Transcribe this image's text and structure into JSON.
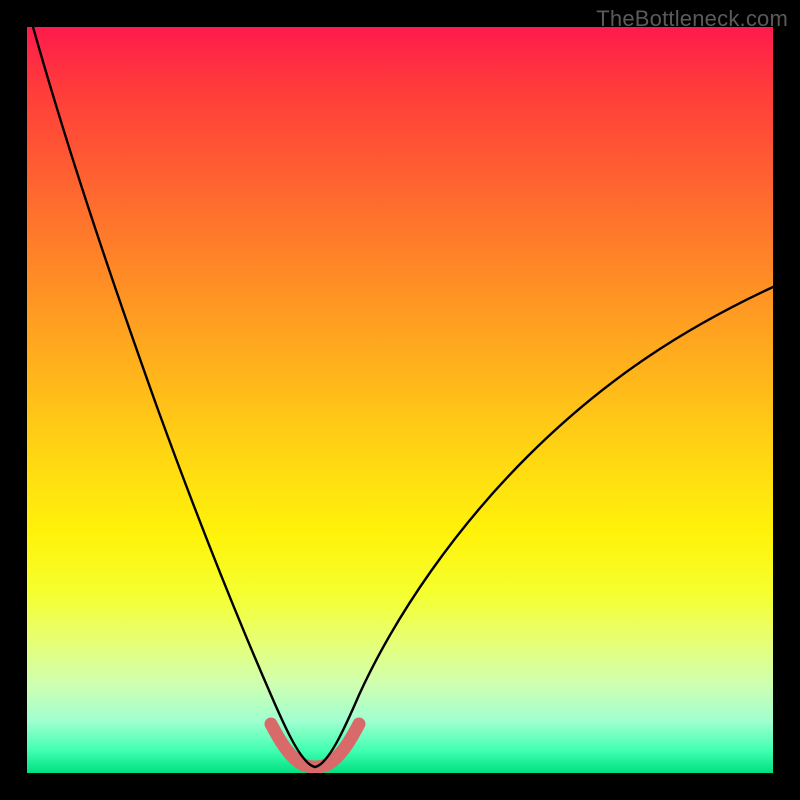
{
  "watermark": "TheBottleneck.com",
  "colors": {
    "background": "#000000",
    "gradient_top": "#ff1a4d",
    "gradient_bottom": "#00e080",
    "curve": "#000000",
    "highlight": "#d86a6a"
  },
  "chart_data": {
    "type": "line",
    "title": "",
    "xlabel": "",
    "ylabel": "",
    "xlim": [
      0,
      100
    ],
    "ylim": [
      0,
      100
    ],
    "grid": false,
    "legend": false,
    "description": "V-shaped bottleneck curve. Two black curved branches descend from upper left and upper right toward a narrow valley near the bottom center (around x≈38). A short dull-red segment marks the optimal (lowest) region across the valley floor.",
    "series": [
      {
        "name": "left-branch",
        "x": [
          0,
          4,
          8,
          12,
          16,
          20,
          24,
          28,
          32,
          34,
          36,
          37,
          38
        ],
        "y": [
          100,
          93,
          84,
          74,
          63,
          51,
          38,
          25,
          12,
          7,
          3,
          1.5,
          1
        ]
      },
      {
        "name": "right-branch",
        "x": [
          38,
          40,
          42,
          46,
          52,
          60,
          70,
          80,
          90,
          100
        ],
        "y": [
          1,
          1.5,
          3,
          8,
          16,
          26,
          37,
          46,
          53,
          59
        ]
      },
      {
        "name": "optimal-region",
        "x": [
          33,
          34,
          35,
          36,
          37,
          38,
          39,
          40,
          41,
          42,
          43
        ],
        "y": [
          7,
          4.5,
          2.8,
          1.8,
          1.2,
          1,
          1.2,
          1.8,
          2.8,
          4.5,
          7
        ]
      }
    ]
  }
}
